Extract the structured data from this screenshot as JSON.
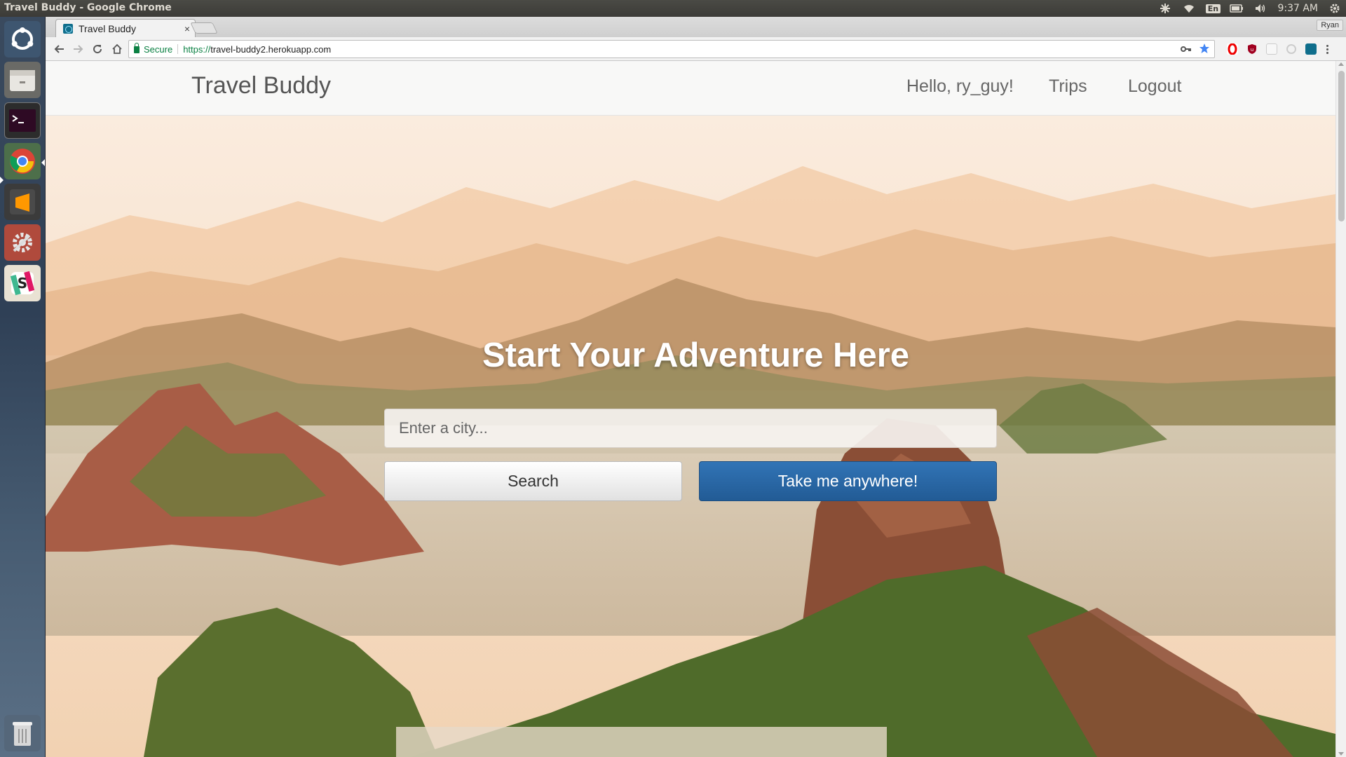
{
  "os_panel": {
    "window_title": "Travel Buddy - Google Chrome",
    "language": "En",
    "clock": "9:37 AM"
  },
  "launcher": {
    "items": [
      "ubuntu-dash-icon",
      "files-icon",
      "terminal-icon",
      "chrome-icon",
      "sublime-text-icon",
      "system-settings-icon",
      "slack-icon",
      "trash-icon"
    ]
  },
  "browser": {
    "tab_title": "Travel Buddy",
    "tab_close": "×",
    "profile_name": "Ryan",
    "secure_label": "Secure",
    "url_scheme": "https://",
    "url_host": "travel-buddy2.herokuapp.com"
  },
  "navbar": {
    "brand": "Travel Buddy",
    "greeting": "Hello, ry_guy!",
    "trips": "Trips",
    "logout": "Logout"
  },
  "hero": {
    "title": "Start Your Adventure Here",
    "search_placeholder": "Enter a city...",
    "search_value": "",
    "search_button": "Search",
    "random_button": "Take me anywhere!"
  },
  "colors": {
    "primary_button": "#2a67a6",
    "secure_green": "#0b8043",
    "hero_text": "#ffffff"
  }
}
